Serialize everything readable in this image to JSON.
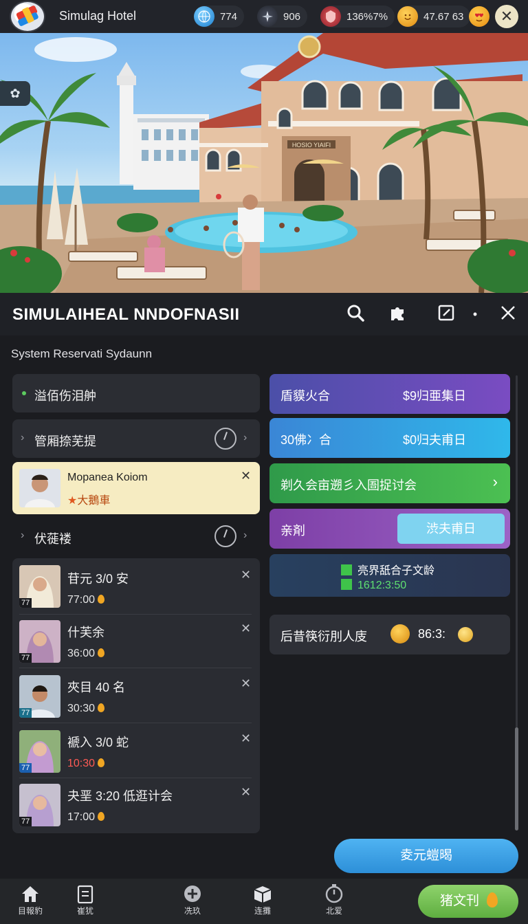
{
  "topbar": {
    "app_title": "Simulag Hotel",
    "resources": [
      {
        "icon": "globe-icon",
        "value": "774"
      },
      {
        "icon": "compass-icon",
        "value": "906"
      },
      {
        "icon": "crest-icon",
        "value": "136%7%"
      },
      {
        "icon": "smiley-coin-icon",
        "value": "47.67 63"
      },
      {
        "icon": "heart-face-icon",
        "value": ""
      }
    ],
    "close_label": "✕"
  },
  "header": {
    "title": "SIMULAIHEAL NNDOFNASII",
    "subtitle": "System Reservati Sydaunn"
  },
  "left": {
    "status_label": "溢佰伤泪舯",
    "section1_label": "管厢捺芜提",
    "guest_card": {
      "name": "Mopanea Koiom",
      "tag": "大鵝車"
    },
    "section2_label": "伏蓰褛",
    "list": [
      {
        "name": "苷元 3/0 安",
        "time": "77:00",
        "level": "77",
        "time_color": "#e8e8e8"
      },
      {
        "name": "什芙余",
        "time": "36:00",
        "level": "77",
        "time_color": "#e8e8e8"
      },
      {
        "name": "夾目 40 名",
        "time": "30:30",
        "level": "77",
        "time_color": "#e8e8e8"
      },
      {
        "name": "褫入 3/0 蛇",
        "time": "10:30",
        "level": "77",
        "time_color": "#ff5b55"
      },
      {
        "name": "夬垩 3:20 低逛计会",
        "time": "17:00",
        "level": "77",
        "time_color": "#e8e8e8"
      }
    ]
  },
  "right": {
    "cards": [
      {
        "left": "盾貘火合",
        "right": "$9归亜集日"
      },
      {
        "left": "30佛冫合",
        "right": "$0归夫甫日"
      },
      {
        "left": "剃久会亩遡彡入圄捉讨会",
        "right": ""
      },
      {
        "left": "亲剤",
        "button": "渋夫甫日"
      },
      {
        "line1": "亮界舐合子文龄",
        "line2": "1612:3:50"
      },
      {
        "left": "后昔筷衍刖人庋",
        "right": "86:3:"
      }
    ],
    "cta_label": "夌元螘暍"
  },
  "bottom_nav": {
    "items": [
      {
        "icon": "home-icon",
        "label": "目報豹"
      },
      {
        "icon": "clipboard-icon",
        "label": "崔犹"
      },
      {
        "icon": "plus-circle-icon",
        "label": "冼玖"
      },
      {
        "icon": "box-icon",
        "label": "连攤"
      },
      {
        "icon": "timer-icon",
        "label": "北爱"
      }
    ],
    "action_label": "猪文刊"
  }
}
